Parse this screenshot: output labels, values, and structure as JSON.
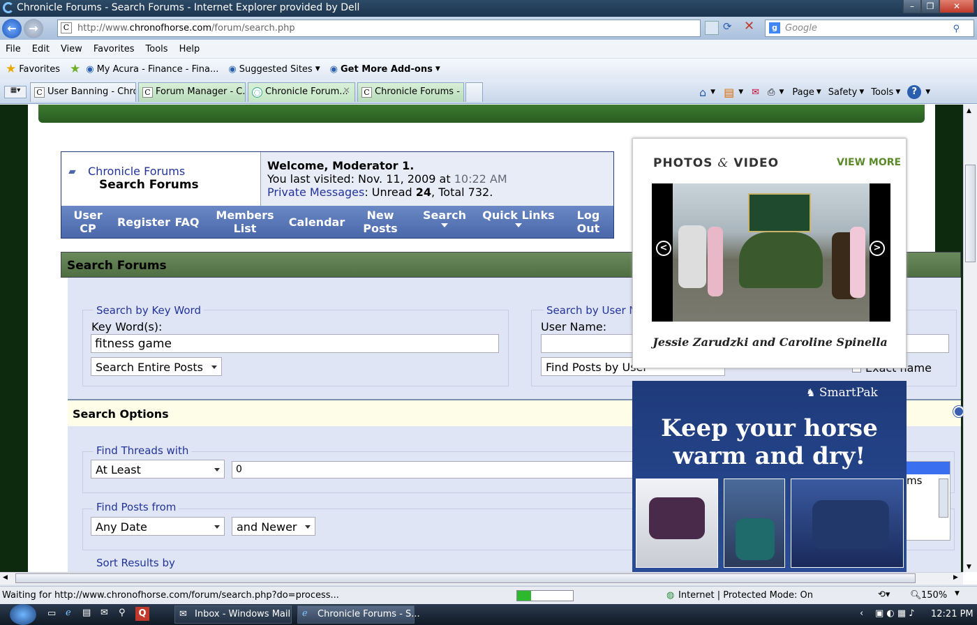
{
  "window": {
    "title": "Chronicle Forums - Search Forums - Internet Explorer provided by Dell"
  },
  "address": {
    "url_prefix": "http://www.",
    "url_domain": "chronofhorse.com",
    "url_path": "/forum/search.php",
    "search_placeholder": "Google"
  },
  "menu": [
    "File",
    "Edit",
    "View",
    "Favorites",
    "Tools",
    "Help"
  ],
  "favorites": {
    "label": "Favorites",
    "items": [
      "My Acura - Finance - Fina...",
      "Suggested Sites",
      "Get More Add-ons"
    ]
  },
  "tabs": [
    "User Banning - Chro...",
    "Forum Manager - C...",
    "Chronicle Forum...",
    "Chronicle Forums - ..."
  ],
  "toolbar": {
    "page": "Page",
    "safety": "Safety",
    "tools": "Tools"
  },
  "forum": {
    "breadcrumb_root": "Chronicle Forums",
    "breadcrumb_current": "Search Forums",
    "welcome": "Welcome, Moderator 1.",
    "last_visited_prefix": "You last visited: Nov. 11, 2009 at ",
    "last_visited_time": "10:22 AM",
    "pm_label": "Private Messages",
    "pm_unread_prefix": ": Unread ",
    "pm_unread": "24",
    "pm_total": ", Total 732.",
    "nav": [
      {
        "line1": "User",
        "line2": "CP"
      },
      {
        "line1": "Register",
        "line2": ""
      },
      {
        "line1": "FAQ",
        "line2": ""
      },
      {
        "line1": "Members",
        "line2": "List"
      },
      {
        "line1": "Calendar",
        "line2": ""
      },
      {
        "line1": "New",
        "line2": "Posts"
      },
      {
        "line1": "Search",
        "line2": ""
      },
      {
        "line1": "Quick Links",
        "line2": ""
      },
      {
        "line1": "Log",
        "line2": "Out"
      }
    ]
  },
  "search": {
    "header": "Search Forums",
    "keyword_legend": "Search by Key Word",
    "keyword_label": "Key Word(s):",
    "keyword_value": "fitness game",
    "keyword_scope": "Search Entire Posts",
    "user_legend": "Search by User Na",
    "user_label": "User Name:",
    "user_scope": "Find Posts by User",
    "exact_name": "Exact name",
    "options_header": "Search Options",
    "threads_legend": "Find Threads with",
    "threads_mode": "At Least",
    "threads_count": "0",
    "posts_legend": "Find Posts from",
    "posts_date": "Any Date",
    "posts_newer": "and Newer",
    "sort_legend": "Sort Results by",
    "list_fragment": "ms"
  },
  "photos": {
    "title_a": "PHOTOS",
    "title_amp": "&",
    "title_b": "VIDEO",
    "view_more": "VIEW MORE",
    "caption": "Jessie Zarudzki and Caroline Spinella"
  },
  "ad": {
    "brand": "SmartPak",
    "headline_1": "Keep your horse",
    "headline_2": "warm and dry!"
  },
  "status": {
    "text": "Waiting for http://www.chronofhorse.com/forum/search.php?do=process...",
    "progress": 0.25,
    "zone": "Internet | Protected Mode: On",
    "zoom": "150%"
  },
  "taskbar": {
    "items": [
      "Inbox - Windows Mail",
      "Chronicle Forums - S..."
    ],
    "clock": "12:21 PM"
  },
  "colors": {
    "link": "#22339a",
    "nav": "#4a68aa",
    "header_green": "#4f6e42",
    "ad_blue": "#1e3a7a"
  }
}
